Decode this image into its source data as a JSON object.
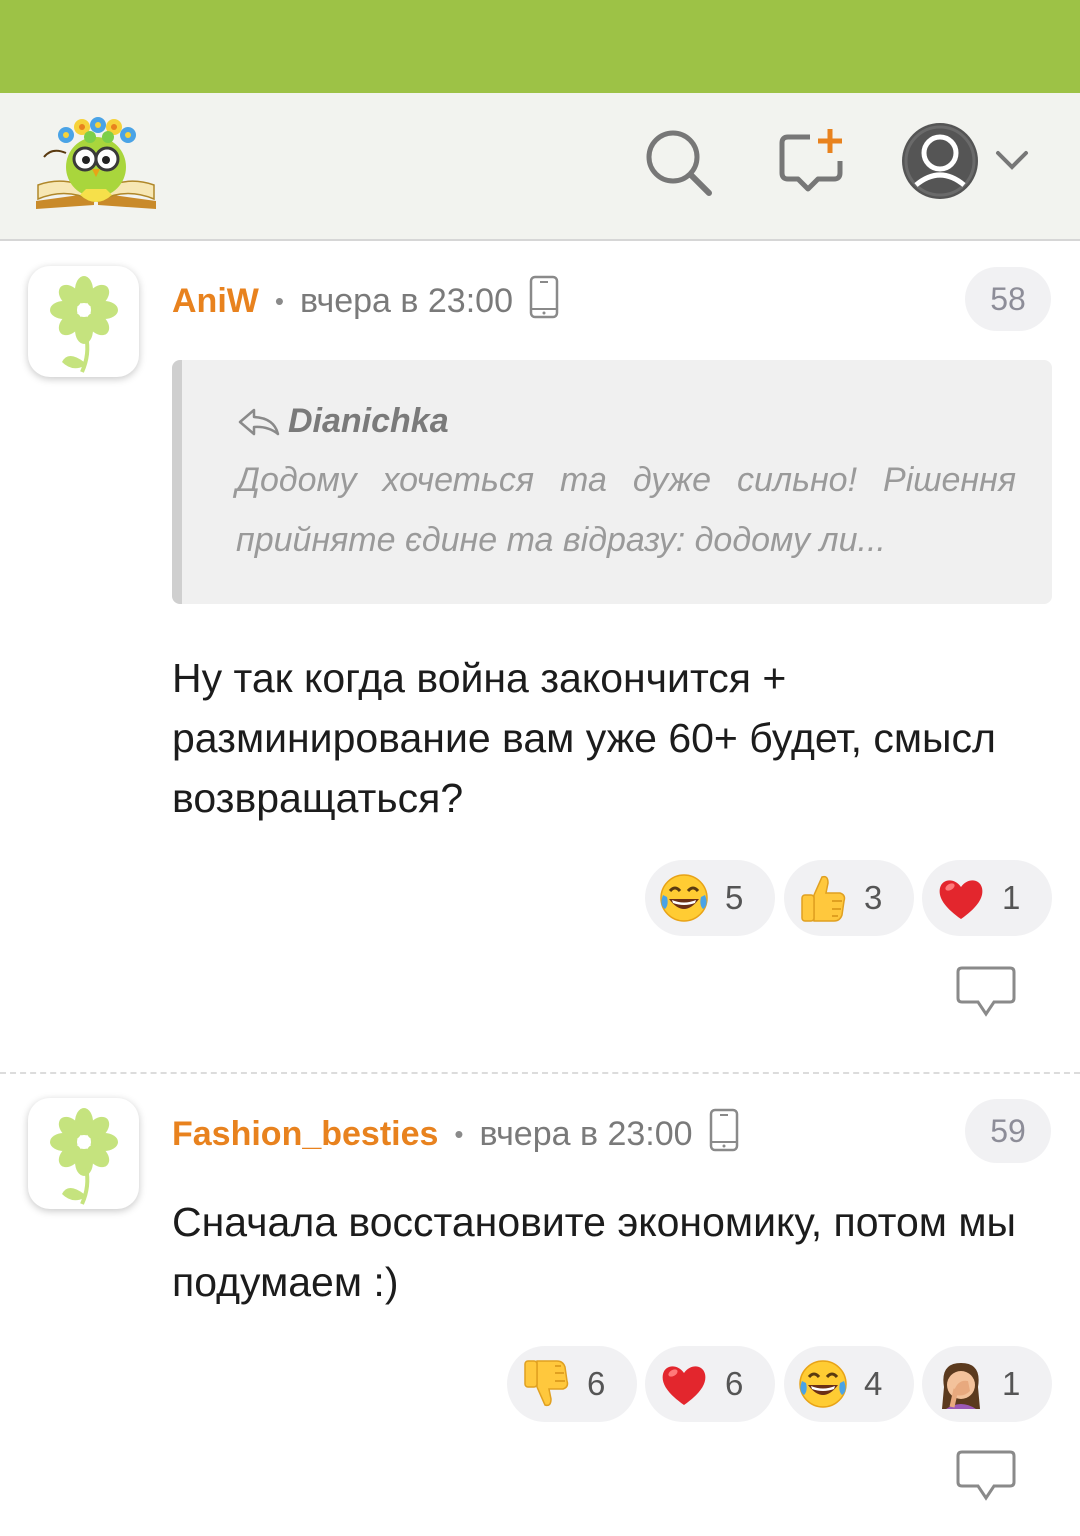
{
  "colors": {
    "status_bar": "#9dc246",
    "header_bg": "#f2f3ef",
    "accent": "#e8821e",
    "badge_bg": "#f1f1f3"
  },
  "header": {
    "logo_icon": "owl-reading-book-logo",
    "search_icon": "search-icon",
    "new_post_icon": "new-chat-plus-icon",
    "profile_icon": "user-avatar-icon",
    "dropdown_icon": "chevron-down-icon"
  },
  "comments": [
    {
      "author": "AniW",
      "separator": "•",
      "time": "вчера в 23:00",
      "device_icon": "mobile-phone-icon",
      "number": "58",
      "quote": {
        "author": "Dianichka",
        "text": "Додому хочеться та дуже сильно! Рішення прийняте єдине та відразу: додому ли..."
      },
      "text": "Ну так когда война закончится + разминирование вам уже 60+ будет, смысл возвращаться?",
      "reactions": [
        {
          "emoji": "laughing-tears-emoji",
          "count": "5"
        },
        {
          "emoji": "thumbs-up-emoji",
          "count": "3"
        },
        {
          "emoji": "red-heart-emoji",
          "count": "1"
        }
      ]
    },
    {
      "author": "Fashion_besties",
      "separator": "•",
      "time": "вчера в 23:00",
      "device_icon": "mobile-phone-icon",
      "number": "59",
      "text": "Сначала восстановите экономику, потом мы подумаем :)",
      "reactions": [
        {
          "emoji": "thumbs-down-emoji",
          "count": "6"
        },
        {
          "emoji": "red-heart-emoji",
          "count": "6"
        },
        {
          "emoji": "laughing-tears-emoji",
          "count": "4"
        },
        {
          "emoji": "facepalm-woman-emoji",
          "count": "1"
        }
      ]
    }
  ]
}
